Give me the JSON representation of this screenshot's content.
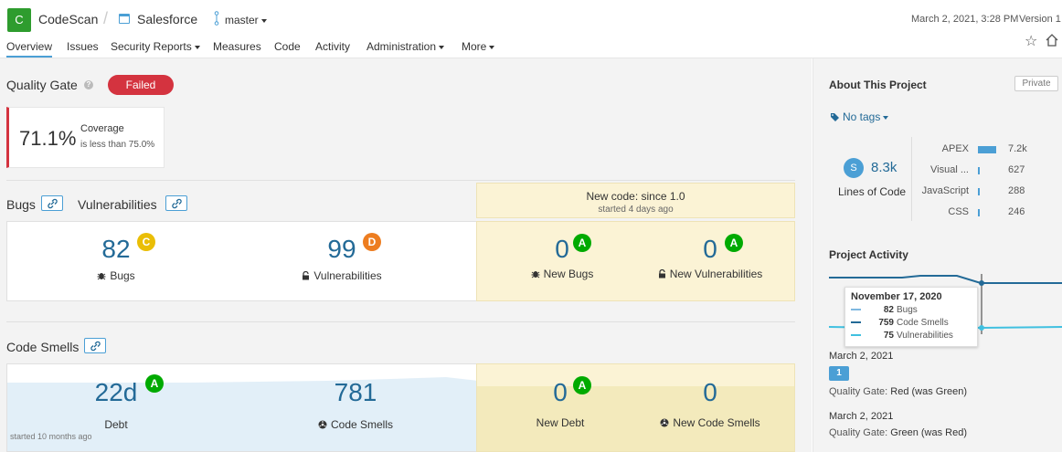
{
  "header": {
    "org_initial": "C",
    "org_name": "CodeScan",
    "project_name": "Salesforce",
    "branch": "master",
    "analysis_date": "March 2, 2021, 3:28 PM",
    "version": "Version 1",
    "accent_color": "#4b9fd5"
  },
  "nav": {
    "overview": "Overview",
    "issues": "Issues",
    "security_reports": "Security Reports",
    "measures": "Measures",
    "code": "Code",
    "activity": "Activity",
    "administration": "Administration",
    "more": "More"
  },
  "quality_gate": {
    "label": "Quality Gate",
    "status": "Failed",
    "status_color": "#d4333f",
    "condition": {
      "value": "71.1%",
      "metric": "Coverage",
      "requirement": "is less than 75.0%"
    }
  },
  "bugs_vulns": {
    "bugs_label": "Bugs",
    "vulns_label": "Vulnerabilities",
    "new_code_title": "New code: since 1.0",
    "new_code_started": "started 4 days ago",
    "bugs": {
      "value": "82",
      "rating": "C",
      "label": "Bugs"
    },
    "vulnerabilities": {
      "value": "99",
      "rating": "D",
      "label": "Vulnerabilities"
    },
    "new_bugs": {
      "value": "0",
      "rating": "A",
      "label": "New Bugs"
    },
    "new_vulnerabilities": {
      "value": "0",
      "rating": "A",
      "label": "New Vulnerabilities"
    }
  },
  "code_smells": {
    "section_label": "Code Smells",
    "debt": {
      "value": "22d",
      "rating": "A",
      "label": "Debt"
    },
    "smells": {
      "value": "781",
      "label": "Code Smells"
    },
    "new_debt": {
      "value": "0",
      "rating": "A",
      "label": "New Debt"
    },
    "new_smells": {
      "value": "0",
      "label": "New Code Smells"
    },
    "started": "started 10 months ago"
  },
  "ratings_colors": {
    "A": "#00aa00",
    "C": "#eabe06",
    "D": "#ed7d20"
  },
  "sidebar": {
    "about_title": "About This Project",
    "private": "Private",
    "tags": "No tags",
    "loc_initial": "S",
    "loc_value": "8.3k",
    "loc_label": "Lines of Code",
    "languages": [
      {
        "name": "APEX",
        "value": "7.2k",
        "share": 0.87
      },
      {
        "name": "Visual ...",
        "value": "627",
        "share": 0.075
      },
      {
        "name": "JavaScript",
        "value": "288",
        "share": 0.035
      },
      {
        "name": "CSS",
        "value": "246",
        "share": 0.03
      }
    ],
    "activity_title": "Project Activity",
    "tooltip": {
      "date": "November 17, 2020",
      "rows": [
        {
          "value": "82",
          "label": "Bugs",
          "color": "#7fb8e0"
        },
        {
          "value": "759",
          "label": "Code Smells",
          "color": "#236a97"
        },
        {
          "value": "75",
          "label": "Vulnerabilities",
          "color": "#40c0e0"
        }
      ]
    },
    "events": [
      {
        "date": "March 2, 2021",
        "badge": "1",
        "gate_label": "Quality Gate:",
        "gate_text": "Red (was Green)"
      },
      {
        "date": "March 2, 2021",
        "gate_label": "Quality Gate:",
        "gate_text": "Green (was Red)"
      }
    ]
  }
}
